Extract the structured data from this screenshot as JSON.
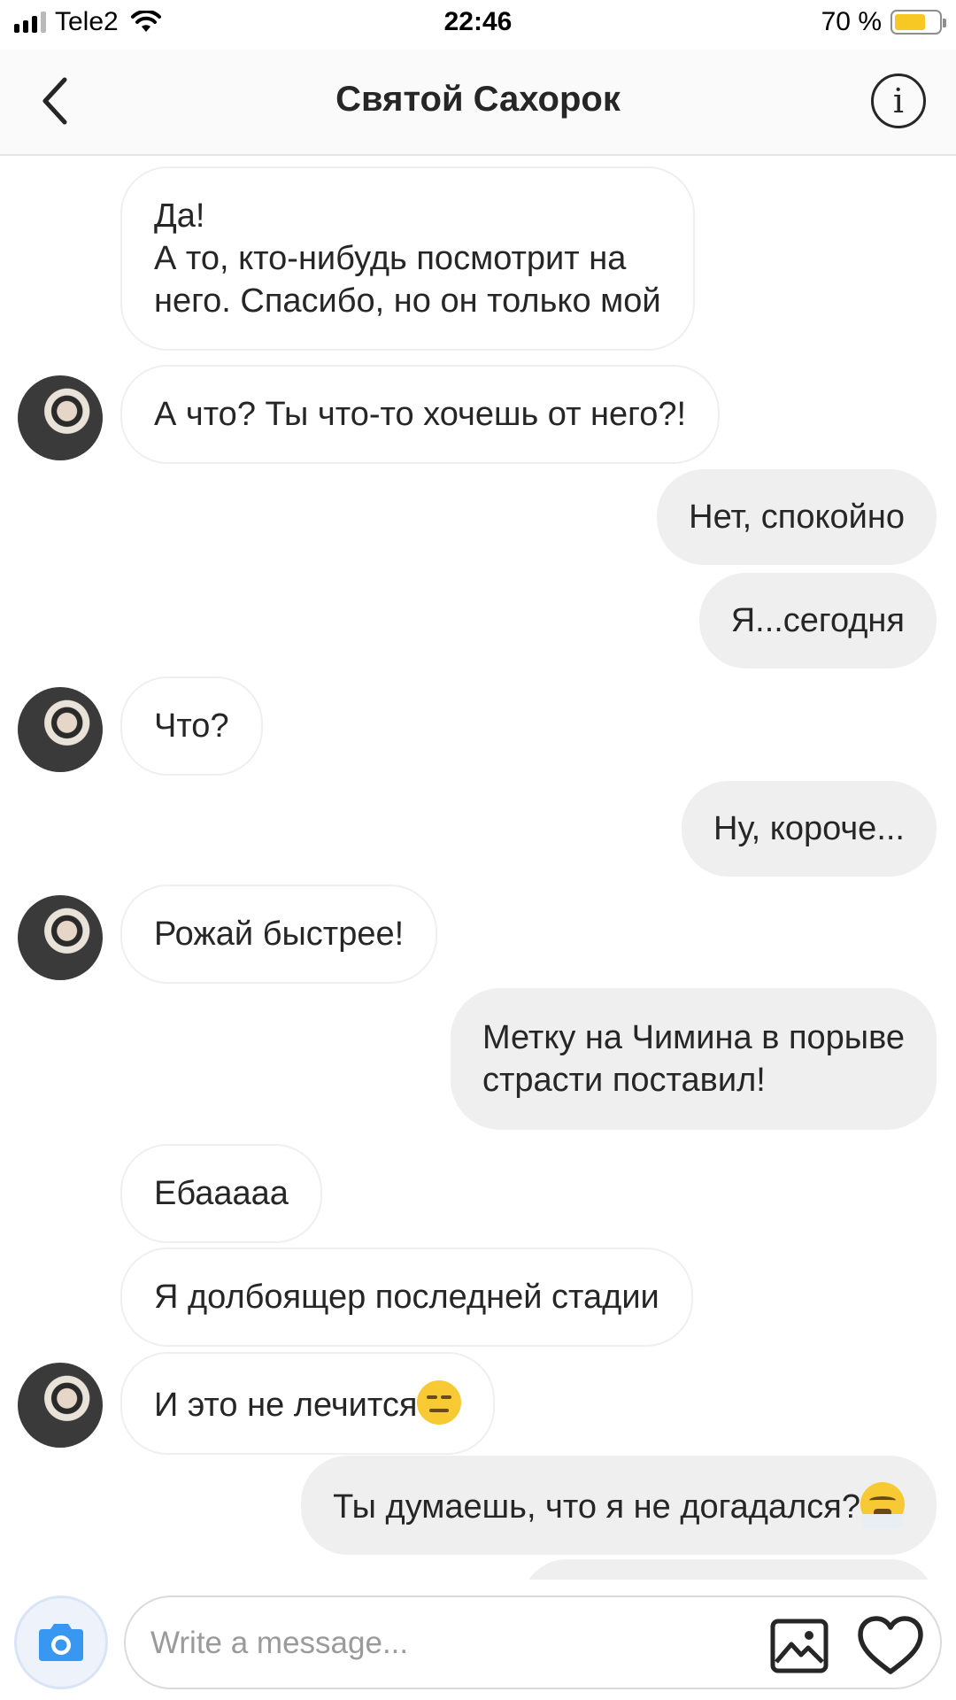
{
  "status_bar": {
    "carrier": "Tele2",
    "time": "22:46",
    "battery": "70 %",
    "battery_level": 0.7
  },
  "header": {
    "title": "Святой Сахорок"
  },
  "messages": [
    {
      "side": "in",
      "text": "Да!\nА то, кто-нибудь посмотрит на\nнего. Спасибо, но он только мой"
    },
    {
      "side": "in",
      "text": "А что? Ты что-то хочешь от него?!",
      "avatar": true
    },
    {
      "side": "out",
      "text": "Нет, спокойно"
    },
    {
      "side": "out",
      "text": "Я...сегодня"
    },
    {
      "side": "in",
      "text": "Что?",
      "avatar": true
    },
    {
      "side": "out",
      "text": "Ну, короче..."
    },
    {
      "side": "in",
      "text": "Рожай быстрее!",
      "avatar": true
    },
    {
      "side": "out",
      "text": "Метку на Чимина в порыве\nстрасти поставил!"
    },
    {
      "side": "in",
      "text": "Ебааааа"
    },
    {
      "side": "in",
      "text": "Я долбоящер последней стадии"
    },
    {
      "side": "in",
      "text": "И это не лечится",
      "avatar": true,
      "emoji": "expressionless-face-emoji"
    },
    {
      "side": "out",
      "text": "Ты думаешь, что я не догадался?",
      "emoji": "face-with-steam-emoji"
    }
  ],
  "composer": {
    "placeholder": "Write a message..."
  },
  "icons": {
    "back": "chevron-left-icon",
    "info": "info-icon",
    "camera": "camera-icon",
    "gallery": "image-icon",
    "like": "heart-icon"
  },
  "colors": {
    "outgoing_bubble": "#efefef",
    "incoming_border": "#efefef",
    "camera_blue": "#3897f0",
    "battery_yellow": "#f7c824"
  }
}
